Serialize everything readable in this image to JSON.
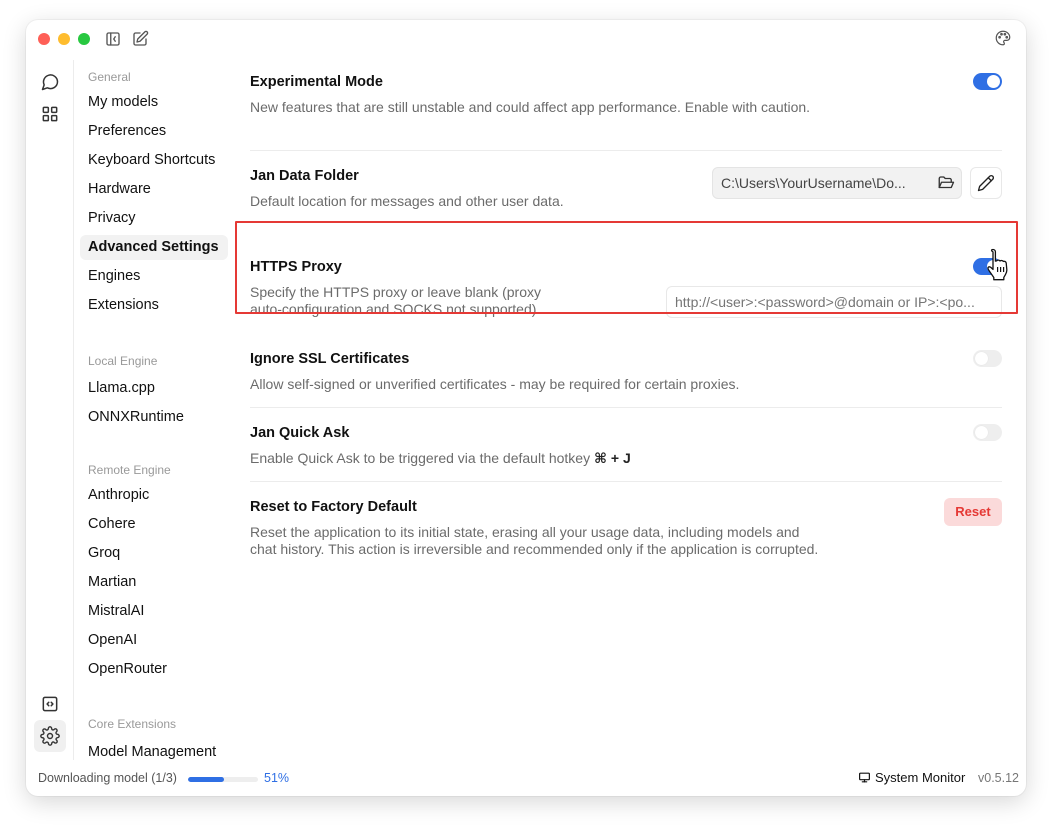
{
  "window": {
    "titlebar_icons": [
      "sidebar-collapse-icon",
      "new-chat-icon",
      "theme-palette-icon"
    ]
  },
  "rail": {
    "items": [
      {
        "name": "chat-icon",
        "active": false
      },
      {
        "name": "hub-grid-icon",
        "active": false
      },
      {
        "name": "api-server-icon",
        "active": false
      },
      {
        "name": "settings-gear-icon",
        "active": true
      }
    ]
  },
  "sidebar": {
    "sections": [
      {
        "title": "General",
        "items": [
          "My models",
          "Preferences",
          "Keyboard Shortcuts",
          "Hardware",
          "Privacy",
          "Advanced Settings",
          "Engines",
          "Extensions"
        ]
      },
      {
        "title": "Local Engine",
        "items": [
          "Llama.cpp",
          "ONNXRuntime"
        ]
      },
      {
        "title": "Remote Engine",
        "items": [
          "Anthropic",
          "Cohere",
          "Groq",
          "Martian",
          "MistralAI",
          "OpenAI",
          "OpenRouter"
        ]
      },
      {
        "title": "Core Extensions",
        "items": [
          "Model Management"
        ]
      }
    ],
    "active_item": "Advanced Settings"
  },
  "settings": {
    "experimental": {
      "title": "Experimental Mode",
      "desc": "New features that are still unstable and could affect app performance. Enable with caution.",
      "enabled": true
    },
    "data_folder": {
      "title": "Jan Data Folder",
      "desc": "Default location for messages and other user data.",
      "value": "C:\\Users\\YourUsername\\Do..."
    },
    "proxy": {
      "title": "HTTPS Proxy",
      "desc_line1": "Specify the HTTPS proxy or leave blank (proxy",
      "desc_line2": "auto-configuration and SOCKS not supported).",
      "enabled": true,
      "placeholder": "http://<user>:<password>@domain or IP>:<po..."
    },
    "ssl": {
      "title": "Ignore SSL Certificates",
      "desc": "Allow self-signed or unverified certificates - may be required for certain proxies.",
      "enabled": false
    },
    "quick_ask": {
      "title": "Jan Quick Ask",
      "desc": "Enable Quick Ask to be triggered via the default hotkey",
      "hotkey": "⌘ + J",
      "enabled": false
    },
    "reset": {
      "title": "Reset to Factory Default",
      "desc_line1": "Reset the application to its initial state, erasing all your usage data, including models and",
      "desc_line2": "chat history. This action is irreversible and recommended only if the application is corrupted.",
      "button_label": "Reset"
    }
  },
  "footer": {
    "download_text": "Downloading model (1/3)",
    "download_progress": 0.51,
    "download_percent": "51%",
    "system_monitor_label": "System Monitor",
    "version": "v0.5.12"
  },
  "colors": {
    "accent": "#2f6fe4",
    "danger": "#e53935",
    "danger_bg": "#fbdada",
    "highlight_border": "#e53935"
  }
}
